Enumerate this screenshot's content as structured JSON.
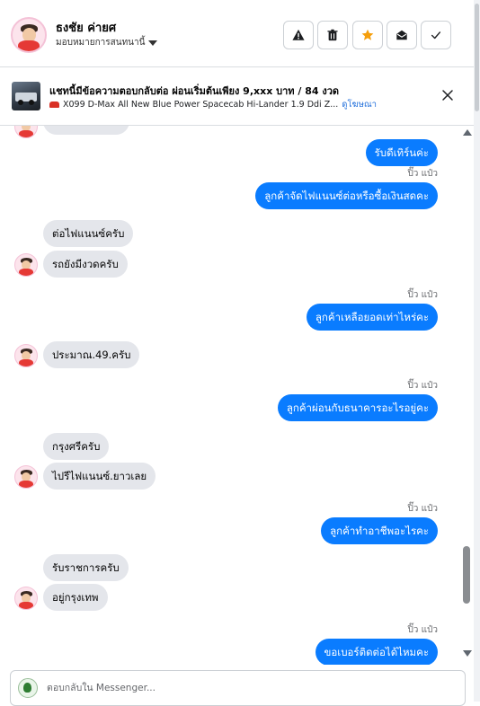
{
  "header": {
    "user_name": "ธงชัย ค่ายศ",
    "assign_label": "มอบหมายการสนทนานี้",
    "icons": [
      "alert-icon",
      "trash-icon",
      "star-icon",
      "mail-open-icon",
      "check-icon"
    ],
    "star_color": "#f59e0b"
  },
  "ad": {
    "title": "แชทนี้มีข้อความตอบกลับต่อ ผ่อนเริ่มต้นเพียง 9,xxx บาท / 84 งวด",
    "subtitle": "X099 D-Max All New Blue Power Spacecab Hi-Lander 1.9 Ddi Z...",
    "link": "ดูโฆษณา"
  },
  "messages": [
    {
      "dir": "in",
      "text": ""
    },
    {
      "dir": "out",
      "text": "รับดีเทิร์นค่ะ"
    },
    {
      "dir": "stamp",
      "text": "ปิ๊ว แป๋ว"
    },
    {
      "dir": "out",
      "text": "ลูกค้าจัดไฟแนนซ์ต่อหรือซื้อเงินสดคะ"
    },
    {
      "dir": "in",
      "text": "ต่อไฟแนนซ์ครับ"
    },
    {
      "dir": "in",
      "text": "รถยังมีงวดครับ"
    },
    {
      "dir": "stamp",
      "text": "ปิ๊ว แป๋ว"
    },
    {
      "dir": "out",
      "text": "ลูกค้าเหลือยอดเท่าไหร่คะ"
    },
    {
      "dir": "in",
      "text": "ประมาณ.49.ครับ"
    },
    {
      "dir": "stamp",
      "text": "ปิ๊ว แป๋ว"
    },
    {
      "dir": "out",
      "text": "ลูกค้าผ่อนกับธนาคารอะไรอยู่คะ"
    },
    {
      "dir": "in",
      "text": "กรุงศรีครับ"
    },
    {
      "dir": "in",
      "text": "ไปรีไฟแนนซ์.ยาวเลย"
    },
    {
      "dir": "stamp",
      "text": "ปิ๊ว แป๋ว"
    },
    {
      "dir": "out",
      "text": "ลูกค้าทำอาชีพอะไรคะ"
    },
    {
      "dir": "in",
      "text": "รับราชการครับ"
    },
    {
      "dir": "in",
      "text": "อยู่กรุงเทพ"
    },
    {
      "dir": "stamp",
      "text": "ปิ๊ว แป๋ว"
    },
    {
      "dir": "out",
      "text": "ขอเบอร์ติดต่อได้ไหมคะ"
    }
  ],
  "composer": {
    "placeholder": "ตอบกลับใน Messenger..."
  },
  "colors": {
    "outgoing_bubble": "#0a7cff",
    "incoming_bubble": "#e4e6eb"
  }
}
